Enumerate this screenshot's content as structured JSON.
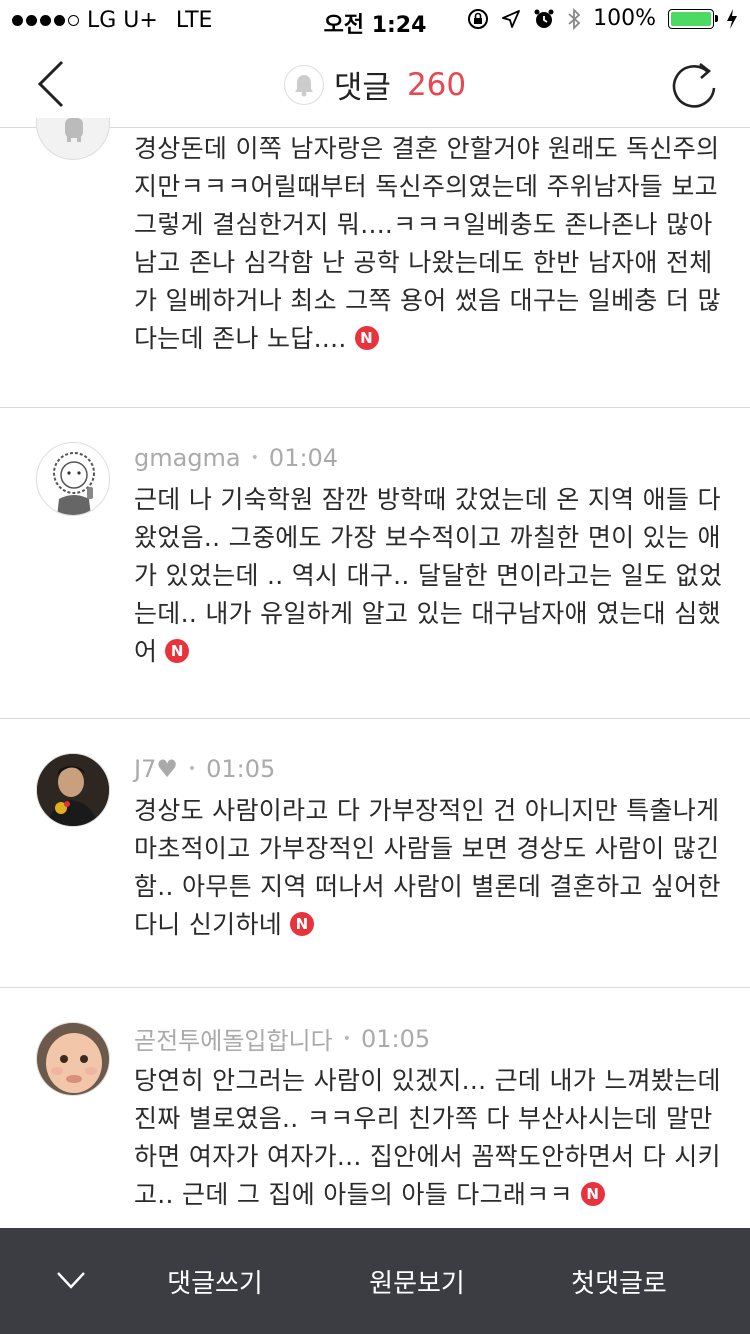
{
  "status": {
    "carrier": "LG U+",
    "network": "LTE",
    "time": "오전 1:24",
    "battery": "100%"
  },
  "header": {
    "title": "댓글",
    "count": "260"
  },
  "comments": [
    {
      "author": "",
      "time": "",
      "text": "경상돈데 이쪽 남자랑은 결혼 안할거야 원래도 독신주의지만ㅋㅋㅋ어릴때부터 독신주의였는데 주위남자들 보고 그렇게 결심한거지 뭐....ㅋㅋㅋ일베충도 존나존나 많아 남고 존나 심각함 난 공학 나왔는데도 한반 남자애 전체가 일베하거나 최소 그쪽 용어 썼음 대구는 일베충 더 많다는데 존나 노답....",
      "badge": "N"
    },
    {
      "author": "gmagma",
      "time": "01:04",
      "text": "근데 나 기숙학원 잠깐 방학때 갔었는데 온 지역 애들 다 왔었음.. 그중에도 가장 보수적이고 까칠한 면이 있는 애가 있었는데 .. 역시 대구.. 달달한 면이라고는 일도 없었는데.. 내가 유일하게 알고 있는 대구남자애 였는대 심했어",
      "badge": "N"
    },
    {
      "author": "J7♥",
      "time": "01:05",
      "text": "경상도 사람이라고 다 가부장적인 건 아니지만 특출나게 마초적이고 가부장적인 사람들 보면 경상도 사람이 많긴함.. 아무튼 지역 떠나서 사람이 별론데 결혼하고 싶어한다니 신기하네",
      "badge": "N"
    },
    {
      "author": "곧전투에돌입합니다",
      "time": "01:05",
      "text": "당연히 안그러는 사람이 있겠지... 근데 내가 느껴봤는데 진짜 별로였음.. ㅋㅋ우리 친가쪽 다 부산사시는데 말만하면 여자가 여자가... 집안에서 꼼짝도안하면서 다 시키고.. 근데 그 집에 아들의 아들 다그래ㅋㅋ",
      "badge": "N"
    }
  ],
  "toolbar": {
    "write": "댓글쓰기",
    "original": "원문보기",
    "first": "첫댓글로"
  },
  "colors": {
    "accent": "#e8474f",
    "toolbar_bg": "#3b3d42",
    "battery": "#4cd964"
  }
}
